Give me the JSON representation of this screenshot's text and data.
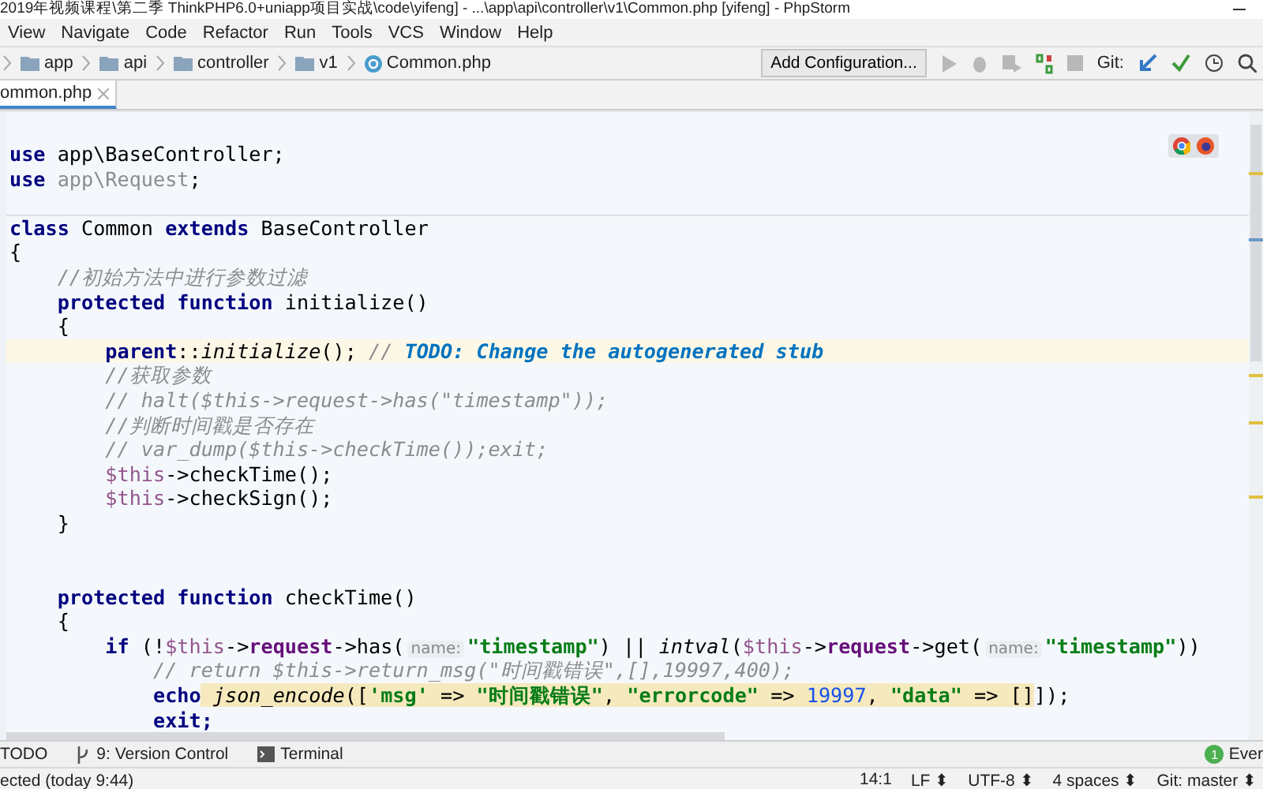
{
  "window": {
    "title": "2019年视频课程\\第二季 ThinkPHP6.0+uniapp项目实战\\code\\yifeng] - ...\\app\\api\\controller\\v1\\Common.php [yifeng] - PhpStorm"
  },
  "menu": [
    "View",
    "Navigate",
    "Code",
    "Refactor",
    "Run",
    "Tools",
    "VCS",
    "Window",
    "Help"
  ],
  "breadcrumbs": [
    {
      "label": "app",
      "kind": "folder"
    },
    {
      "label": "api",
      "kind": "folder"
    },
    {
      "label": "controller",
      "kind": "folder"
    },
    {
      "label": "v1",
      "kind": "folder"
    },
    {
      "label": "Common.php",
      "kind": "class"
    }
  ],
  "toolbar": {
    "config": "Add Configuration...",
    "git_label": "Git:"
  },
  "tabs": [
    {
      "label": "ommon.php",
      "selected": true
    }
  ],
  "code": [
    {
      "tokens": [
        {
          "kind": "kw",
          "text": "use"
        },
        {
          "kind": "plain",
          "text": " app\\BaseController;"
        }
      ]
    },
    {
      "tokens": [
        {
          "kind": "kw",
          "text": "use "
        },
        {
          "kind": "unused",
          "text": "app\\Request"
        },
        {
          "kind": "plain",
          "text": ";"
        }
      ]
    },
    {
      "kind": "blank"
    },
    {
      "divider_above": true,
      "tokens": [
        {
          "kind": "kw",
          "text": "class"
        },
        {
          "kind": "plain",
          "text": " Common "
        },
        {
          "kind": "kw",
          "text": "extends"
        },
        {
          "kind": "plain",
          "text": " BaseController"
        }
      ]
    },
    {
      "tokens": [
        {
          "kind": "plain",
          "text": "{"
        }
      ]
    },
    {
      "tokens": [
        {
          "kind": "comment",
          "text": "    //初始方法中进行参数过滤"
        }
      ]
    },
    {
      "tokens": [
        {
          "kind": "kw",
          "text": "    protected function"
        },
        {
          "kind": "plain",
          "text": " initialize()"
        }
      ]
    },
    {
      "tokens": [
        {
          "kind": "plain",
          "text": "    {"
        }
      ]
    },
    {
      "highlight": true,
      "tokens": [
        {
          "kind": "kw",
          "text": "        parent"
        },
        {
          "kind": "plain",
          "text": "::"
        },
        {
          "kind": "fn",
          "text": "initialize"
        },
        {
          "kind": "plain",
          "text": "(); "
        },
        {
          "kind": "comment",
          "text": "// "
        },
        {
          "kind": "todo",
          "text": "TODO: Change the autogenerated stub"
        }
      ]
    },
    {
      "tokens": [
        {
          "kind": "comment",
          "text": "        //获取参数"
        }
      ]
    },
    {
      "tokens": [
        {
          "kind": "comment",
          "text": "        // halt($this->request->has(\"timestamp\"));"
        }
      ]
    },
    {
      "tokens": [
        {
          "kind": "comment",
          "text": "        //判断时间戳是否存在"
        }
      ]
    },
    {
      "tokens": [
        {
          "kind": "comment",
          "text": "        // var_dump($this->checkTime());exit;"
        }
      ]
    },
    {
      "tokens": [
        {
          "kind": "var",
          "text": "        $this"
        },
        {
          "kind": "plain",
          "text": "->checkTime();"
        }
      ]
    },
    {
      "tokens": [
        {
          "kind": "var",
          "text": "        $this"
        },
        {
          "kind": "plain",
          "text": "->checkSign();"
        }
      ]
    },
    {
      "tokens": [
        {
          "kind": "plain",
          "text": "    }"
        }
      ]
    },
    {
      "kind": "blank"
    },
    {
      "kind": "blank"
    },
    {
      "tokens": [
        {
          "kind": "kw",
          "text": "    protected function"
        },
        {
          "kind": "plain",
          "text": " checkTime()"
        }
      ]
    },
    {
      "tokens": [
        {
          "kind": "plain",
          "text": "    {"
        }
      ]
    },
    {
      "tokens": [
        {
          "kind": "kw",
          "text": "        if"
        },
        {
          "kind": "plain",
          "text": " (!"
        },
        {
          "kind": "var",
          "text": "$this"
        },
        {
          "kind": "plain",
          "text": "->"
        },
        {
          "kind": "field",
          "text": "request"
        },
        {
          "kind": "plain",
          "text": "->has("
        },
        {
          "kind": "hint",
          "text": "name:"
        },
        {
          "kind": "string",
          "text": "\"timestamp\""
        },
        {
          "kind": "plain",
          "text": ") || "
        },
        {
          "kind": "fn",
          "text": "intval"
        },
        {
          "kind": "plain",
          "text": "("
        },
        {
          "kind": "var",
          "text": "$this"
        },
        {
          "kind": "plain",
          "text": "->"
        },
        {
          "kind": "field",
          "text": "request"
        },
        {
          "kind": "plain",
          "text": "->get("
        },
        {
          "kind": "hint",
          "text": "name:"
        },
        {
          "kind": "string",
          "text": "\"timestamp\""
        },
        {
          "kind": "plain",
          "text": "))"
        }
      ]
    },
    {
      "tokens": [
        {
          "kind": "comment",
          "text": "            // return $this->return_msg(\"时间戳错误\",[],19997,400);"
        }
      ]
    },
    {
      "tokens": [
        {
          "kind": "kw",
          "text": "            echo"
        },
        {
          "kind": "usage",
          "children": [
            {
              "kind": "fn",
              "text": " json_encode"
            },
            {
              "kind": "plain",
              "text": "(["
            },
            {
              "kind": "string",
              "text": "'msg'"
            },
            {
              "kind": "plain",
              "text": " => "
            },
            {
              "kind": "string",
              "text": "\"时间戳错误\""
            },
            {
              "kind": "plain",
              "text": ", "
            },
            {
              "kind": "string",
              "text": "\"errorcode\""
            },
            {
              "kind": "plain",
              "text": " => "
            },
            {
              "kind": "num",
              "text": "19997"
            },
            {
              "kind": "plain",
              "text": ", "
            },
            {
              "kind": "string",
              "text": "\"data\""
            },
            {
              "kind": "plain",
              "text": " => []"
            }
          ]
        },
        {
          "kind": "plain",
          "text": "]);"
        }
      ]
    },
    {
      "tokens": [
        {
          "kind": "kw",
          "text": "            exit;"
        }
      ]
    }
  ],
  "tool_windows": [
    {
      "label": "TODO",
      "kind": "todo"
    },
    {
      "label": "9: Version Control",
      "kind": "vcs"
    },
    {
      "label": "Terminal",
      "kind": "terminal"
    }
  ],
  "event_log": {
    "badge": "1",
    "label": "Ever"
  },
  "status_bar": {
    "message": "ected (today 9:44)",
    "items": [
      "14:1",
      "LF ⬍",
      "UTF-8 ⬍",
      "4 spaces ⬍",
      "Git: master ⬍"
    ]
  }
}
